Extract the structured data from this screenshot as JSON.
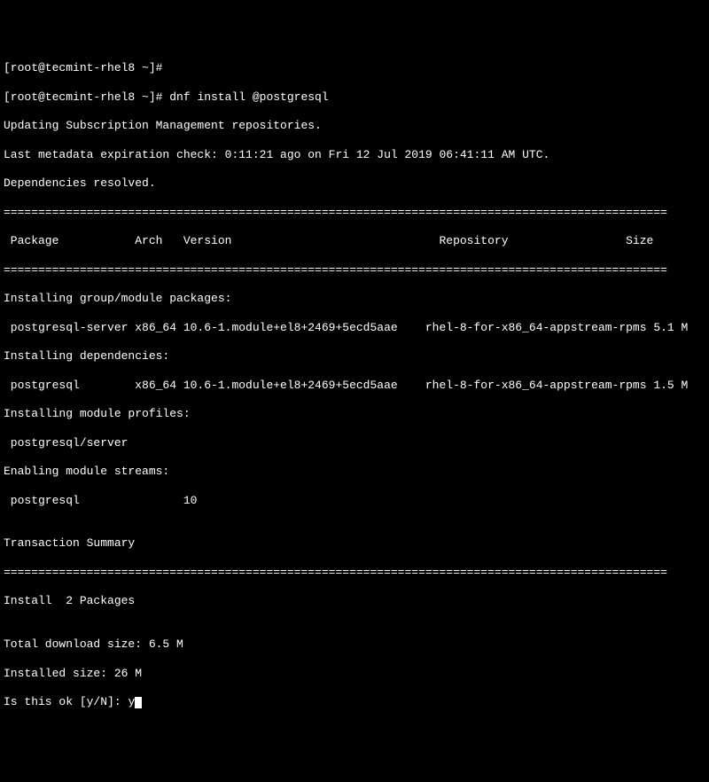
{
  "prompt1": "[root@tecmint-rhel8 ~]# ",
  "prompt2": "[root@tecmint-rhel8 ~]# ",
  "command": "dnf install @postgresql",
  "line_updating": "Updating Subscription Management repositories.",
  "line_metadata": "Last metadata expiration check: 0:11:21 ago on Fri 12 Jul 2019 06:41:11 AM UTC.",
  "line_deps_resolved": "Dependencies resolved.",
  "rule": "================================================================================================",
  "header": " Package           Arch   Version                              Repository                 Size",
  "section_group": "Installing group/module packages:",
  "row1": " postgresql-server x86_64 10.6-1.module+el8+2469+5ecd5aae    rhel-8-for-x86_64-appstream-rpms 5.1 M",
  "section_deps": "Installing dependencies:",
  "row2": " postgresql        x86_64 10.6-1.module+el8+2469+5ecd5aae    rhel-8-for-x86_64-appstream-rpms 1.5 M",
  "section_profiles": "Installing module profiles:",
  "row3": " postgresql/server",
  "section_streams": "Enabling module streams:",
  "row4": " postgresql               10",
  "blank": "",
  "transaction_summary": "Transaction Summary",
  "install_count": "Install  2 Packages",
  "download_size": "Total download size: 6.5 M",
  "installed_size": "Installed size: 26 M",
  "confirm_prompt": "Is this ok [y/N]: ",
  "confirm_input": "y"
}
